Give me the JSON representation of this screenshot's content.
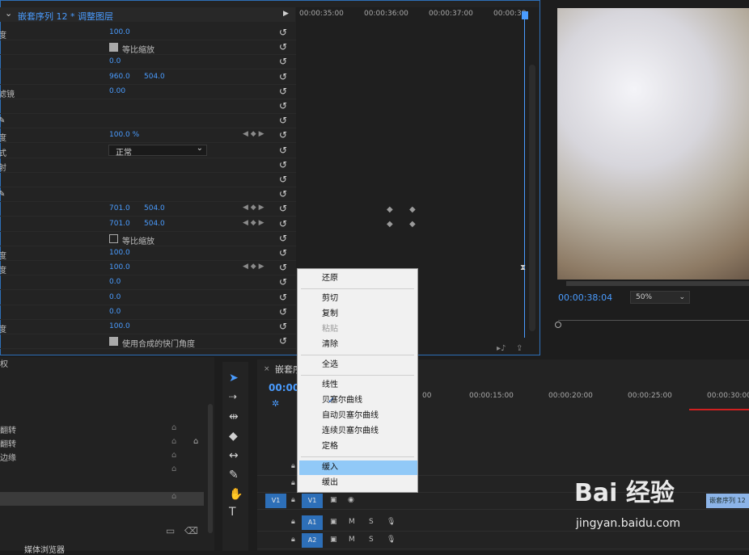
{
  "effect_controls": {
    "title": "嵌套序列 12 * 调整图层",
    "timeline_ticks": [
      "00:00:35:00",
      "00:00:36:00",
      "00:00:37:00",
      "00:00:38"
    ],
    "rows": [
      {
        "label": "度",
        "v1": "100.0",
        "v2": ""
      },
      {
        "label": "",
        "checkbox": true,
        "checked": true,
        "check_label": "等比缩放"
      },
      {
        "label": "",
        "v1": "0.0",
        "v2": ""
      },
      {
        "label": "",
        "v1": "960.0",
        "v2": "504.0"
      },
      {
        "label": "滤镜",
        "v1": "0.00",
        "v2": ""
      },
      {
        "label": "",
        "v1": "",
        "v2": ""
      },
      {
        "label": "",
        "v1": "",
        "v2": "",
        "pen": true
      },
      {
        "label": "度",
        "v1": "100.0 %",
        "v2": "",
        "keyframe": true
      },
      {
        "label": "式",
        "dropdown": "正常"
      },
      {
        "label": "射",
        "v1": "",
        "v2": ""
      },
      {
        "label": "",
        "v1": "",
        "v2": ""
      },
      {
        "label": "",
        "v1": "",
        "v2": "",
        "pen": true
      },
      {
        "label": "",
        "v1": "701.0",
        "v2": "504.0",
        "keyframe": true
      },
      {
        "label": "",
        "v1": "701.0",
        "v2": "504.0",
        "keyframe": true
      },
      {
        "label": "",
        "checkbox": true,
        "checked": false,
        "check_label": "等比缩放"
      },
      {
        "label": "度",
        "v1": "100.0",
        "v2": ""
      },
      {
        "label": "度",
        "v1": "100.0",
        "v2": "",
        "keyframe": true
      },
      {
        "label": "",
        "v1": "0.0",
        "v2": ""
      },
      {
        "label": "",
        "v1": "0.0",
        "v2": ""
      },
      {
        "label": "",
        "v1": "0.0",
        "v2": ""
      },
      {
        "label": "度",
        "v1": "100.0",
        "v2": ""
      },
      {
        "label": "",
        "checkbox": true,
        "checked": true,
        "check_label": "使用合成的快门角度"
      }
    ]
  },
  "program_monitor": {
    "timecode": "00:00:38:04",
    "zoom": "50%"
  },
  "project_panel": {
    "items": [
      "权",
      "",
      "",
      "翻转",
      "翻转",
      "边缘",
      "",
      "",
      ""
    ]
  },
  "timeline": {
    "tab": "嵌套序",
    "timecode": "00:00",
    "ticks": [
      "00",
      "00:00:15:00",
      "00:00:20:00",
      "00:00:25:00",
      "00:00:30:00"
    ],
    "tracks": [
      {
        "name": "V1",
        "label": "V1"
      },
      {
        "name": "A1",
        "label": "A1"
      },
      {
        "name": "A2",
        "label": "A2"
      }
    ],
    "clip": "嵌套序列 12"
  },
  "context_menu": {
    "items": [
      {
        "label": "还原",
        "disabled": false
      },
      {
        "label": "剪切",
        "disabled": false
      },
      {
        "label": "复制",
        "disabled": false
      },
      {
        "label": "粘贴",
        "disabled": true
      },
      {
        "label": "清除",
        "disabled": false
      },
      {
        "label": "全选",
        "disabled": false
      },
      {
        "label": "线性",
        "disabled": false
      },
      {
        "label": "贝塞尔曲线",
        "disabled": false,
        "checked": true
      },
      {
        "label": "自动贝塞尔曲线",
        "disabled": false
      },
      {
        "label": "连续贝塞尔曲线",
        "disabled": false
      },
      {
        "label": "定格",
        "disabled": false
      },
      {
        "label": "缓入",
        "disabled": false,
        "selected": true
      },
      {
        "label": "缓出",
        "disabled": false
      }
    ]
  },
  "bottom_tab": "媒体浏览器",
  "watermark": {
    "brand": "Bai 经验",
    "url": "jingyan.baidu.com"
  },
  "colors": {
    "accent": "#4a9cff",
    "panel": "#232323",
    "menu_bg": "#f1f1f1",
    "menu_selected": "#91c9f7"
  }
}
